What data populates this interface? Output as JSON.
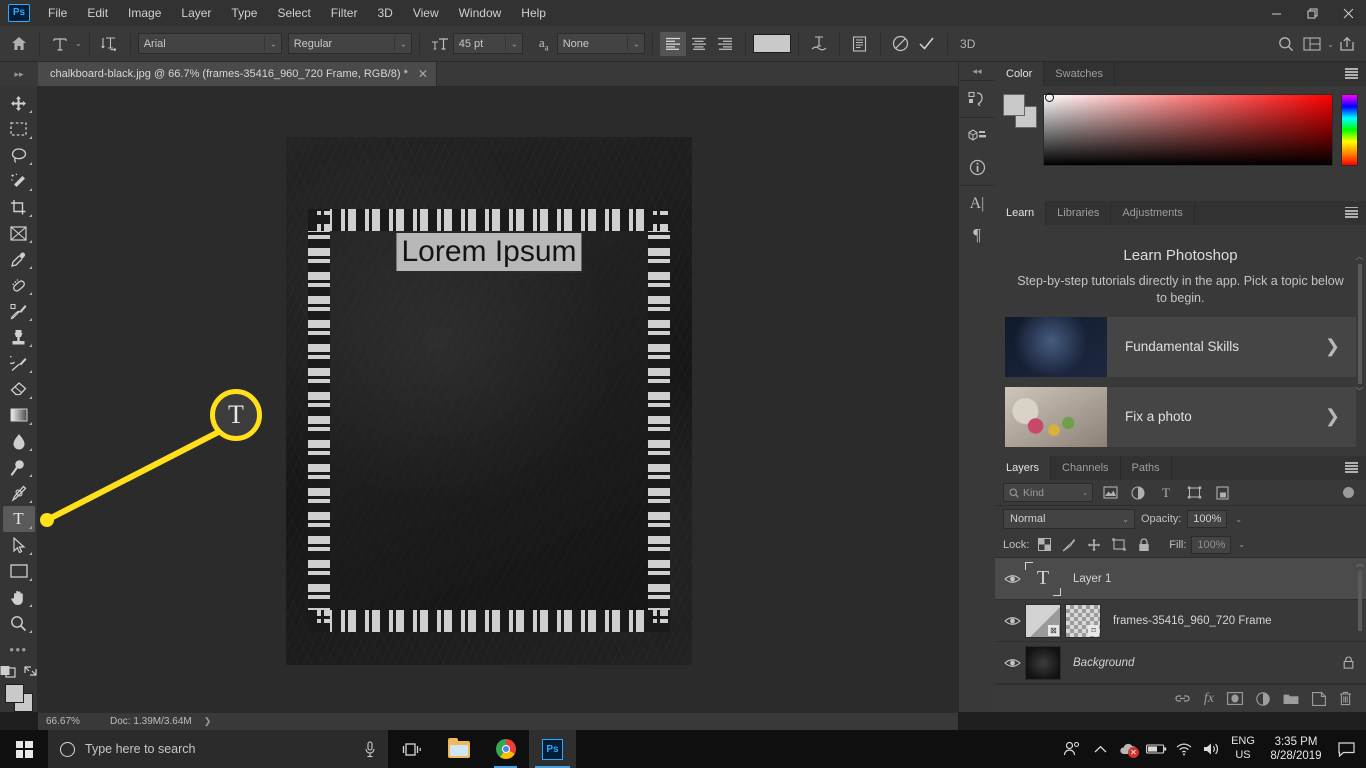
{
  "app": {
    "name": "Ps",
    "logo_label": "Ps"
  },
  "menubar": {
    "items": [
      "File",
      "Edit",
      "Image",
      "Layer",
      "Type",
      "Select",
      "Filter",
      "3D",
      "View",
      "Window",
      "Help"
    ]
  },
  "window_controls": {
    "minimize": "—",
    "restore": "❐",
    "close": "✕"
  },
  "options_bar": {
    "home_icon": "home-icon",
    "tool_preset_icon": "type-tool-icon",
    "text_orientation_icon": "toggle-text-orientation-icon",
    "font_family": "Arial",
    "font_style": "Regular",
    "font_size": "45 pt",
    "size_icon": "font-size-icon",
    "antialias_icon": "anti-aliasing-icon",
    "antialias_value": "None",
    "align_left": "align-left",
    "align_center": "align-center",
    "align_right": "align-right",
    "color_swatch": "#c9c9c9",
    "warp_icon": "create-warped-text-icon",
    "panels_icon": "character-paragraph-panels-icon",
    "cancel_icon": "⊘",
    "commit_icon": "✓",
    "three_d_label": "3D",
    "search_icon": "search-icon",
    "arrange_icon": "arrange-documents-icon",
    "share_icon": "share-icon"
  },
  "document_tab": {
    "title": "chalkboard-black.jpg @ 66.7%  (frames-35416_960_720 Frame, RGB/8) *",
    "close": "✕"
  },
  "toolbar": {
    "tools": [
      {
        "name": "move-tool",
        "glyph": "move"
      },
      {
        "name": "rectangular-marquee-tool",
        "glyph": "marquee"
      },
      {
        "name": "lasso-tool",
        "glyph": "lasso"
      },
      {
        "name": "object-selection-tool",
        "glyph": "wand"
      },
      {
        "name": "crop-tool",
        "glyph": "crop"
      },
      {
        "name": "frame-tool",
        "glyph": "frame"
      },
      {
        "name": "eyedropper-tool",
        "glyph": "eyedropper"
      },
      {
        "name": "spot-healing-brush-tool",
        "glyph": "healing"
      },
      {
        "name": "brush-tool",
        "glyph": "brush"
      },
      {
        "name": "clone-stamp-tool",
        "glyph": "stamp"
      },
      {
        "name": "history-brush-tool",
        "glyph": "historybrush"
      },
      {
        "name": "eraser-tool",
        "glyph": "eraser"
      },
      {
        "name": "gradient-tool",
        "glyph": "gradient"
      },
      {
        "name": "blur-tool",
        "glyph": "blur"
      },
      {
        "name": "dodge-tool",
        "glyph": "dodge"
      },
      {
        "name": "pen-tool",
        "glyph": "pen"
      },
      {
        "name": "horizontal-type-tool",
        "glyph": "type",
        "selected": true
      },
      {
        "name": "path-selection-tool",
        "glyph": "pathselect"
      },
      {
        "name": "rectangle-tool",
        "glyph": "rectangle"
      },
      {
        "name": "hand-tool",
        "glyph": "hand"
      },
      {
        "name": "zoom-tool",
        "glyph": "zoom"
      },
      {
        "name": "edit-toolbar-button",
        "glyph": "dots"
      }
    ],
    "foreground_color": "#c9c9c9",
    "background_color": "#c9c9c9"
  },
  "canvas": {
    "text_layer_content": "Lorem Ipsum",
    "annotation": {
      "magnifier_glyph": "T",
      "color": "#ffe01b",
      "points_to": "horizontal-type-tool"
    }
  },
  "status_bar": {
    "zoom": "66.67%",
    "doc_info": "Doc: 1.39M/3.64M",
    "arrow": "❯"
  },
  "icon_dock": {
    "collapse": "◂◂",
    "icons": [
      {
        "name": "history-panel-icon",
        "glyph": "history"
      },
      {
        "name": "properties-panel-icon",
        "glyph": "properties"
      },
      {
        "name": "info-panel-icon",
        "glyph": "info"
      },
      {
        "name": "character-panel-icon",
        "glyph": "character"
      },
      {
        "name": "paragraph-panel-icon",
        "glyph": "paragraph"
      }
    ]
  },
  "color_panel": {
    "tabs": [
      {
        "label": "Color",
        "active": true
      },
      {
        "label": "Swatches",
        "active": false
      }
    ],
    "foreground": "#c9c9c9",
    "background": "#c9c9c9"
  },
  "learn_panel": {
    "tabs": [
      {
        "label": "Learn",
        "active": true
      },
      {
        "label": "Libraries",
        "active": false
      },
      {
        "label": "Adjustments",
        "active": false
      }
    ],
    "title": "Learn Photoshop",
    "subtitle": "Step-by-step tutorials directly in the app. Pick a topic below to begin.",
    "cards": [
      {
        "label": "Fundamental Skills",
        "chevron": "❯",
        "thumb": "dark-room-photo"
      },
      {
        "label": "Fix a photo",
        "chevron": "❯",
        "thumb": "flowers-photo"
      }
    ]
  },
  "layers_panel": {
    "tabs": [
      {
        "label": "Layers",
        "active": true
      },
      {
        "label": "Channels",
        "active": false
      },
      {
        "label": "Paths",
        "active": false
      }
    ],
    "filter": {
      "kind_label": "Kind",
      "icons": [
        "filter-pixel-icon",
        "filter-adjustment-icon",
        "filter-type-icon",
        "filter-shape-icon",
        "filter-smartobject-icon"
      ]
    },
    "blend_mode": "Normal",
    "opacity_label": "Opacity:",
    "opacity_value": "100%",
    "lock_label": "Lock:",
    "lock_icons": [
      "lock-transparent-pixels-icon",
      "lock-image-pixels-icon",
      "lock-position-icon",
      "lock-artboard-nesting-icon",
      "lock-all-icon"
    ],
    "fill_label": "Fill:",
    "fill_value": "100%",
    "layers": [
      {
        "name": "Layer 1",
        "visible": true,
        "type": "text",
        "selected": true,
        "locked": false,
        "italic": false
      },
      {
        "name": "frames-35416_960_720 Frame",
        "visible": true,
        "type": "frame",
        "selected": false,
        "locked": false,
        "italic": false
      },
      {
        "name": "Background",
        "visible": true,
        "type": "background",
        "selected": false,
        "locked": true,
        "italic": true
      }
    ],
    "footer_icons": [
      {
        "name": "link-layers-icon",
        "glyph": "link"
      },
      {
        "name": "layer-style-icon",
        "glyph": "fx"
      },
      {
        "name": "add-layer-mask-icon",
        "glyph": "mask"
      },
      {
        "name": "new-adjustment-layer-icon",
        "glyph": "adjust"
      },
      {
        "name": "new-group-icon",
        "glyph": "group"
      },
      {
        "name": "new-layer-icon",
        "glyph": "newlayer"
      },
      {
        "name": "delete-layer-icon",
        "glyph": "trash"
      }
    ]
  },
  "taskbar": {
    "start": "start-button",
    "search_placeholder": "Type here to search",
    "cortana_icon": "microphone-icon",
    "taskview_icon": "task-view-icon",
    "apps": [
      {
        "name": "file-explorer",
        "running": false
      },
      {
        "name": "google-chrome",
        "running": true
      },
      {
        "name": "photoshop",
        "running": true,
        "active": true
      }
    ],
    "tray": {
      "people_icon": "people-icon",
      "overflow_icon": "show-hidden-icons-icon",
      "onedrive_icon": "onedrive-error-icon",
      "battery_icon": "battery-icon",
      "wifi_icon": "wifi-icon",
      "volume_icon": "volume-icon",
      "language_line1": "ENG",
      "language_line2": "US",
      "time": "3:35 PM",
      "date": "8/28/2019",
      "action_center_icon": "action-center-icon"
    }
  }
}
